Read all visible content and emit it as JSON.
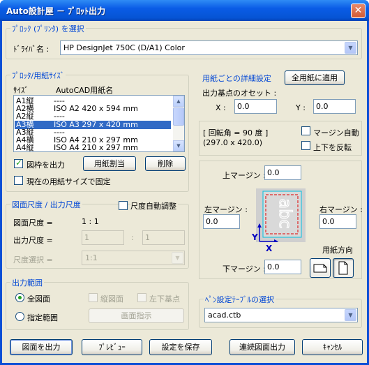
{
  "window": {
    "title": "Auto設計屋 － ﾌﾟﾛｯﾄ出力",
    "close_glyph": "✕"
  },
  "plotter": {
    "group_title": "ﾌﾟﾛｯｸ (ﾌﾟﾘﾝﾀ) を選択",
    "driver_label": "ﾄﾞﾗｲﾊﾞ名 :",
    "driver_value": "HP DesignJet 750C (D/A1) Color"
  },
  "paper_size": {
    "group_title": "ﾌﾟﾛｯﾀ/用紙ｻｲｽﾞ",
    "col_size": "ｻｲｽﾞ",
    "col_autocad": "AutoCAD用紙名",
    "rows": [
      {
        "size": "A1縦",
        "name": "----"
      },
      {
        "size": "A2横",
        "name": "ISO A2 420 x 594 mm"
      },
      {
        "size": "A2縦",
        "name": "----"
      },
      {
        "size": "A3横",
        "name": "ISO A3 297 x 420 mm"
      },
      {
        "size": "A3縦",
        "name": "----"
      },
      {
        "size": "A4横",
        "name": "ISO A4 210 x 297 mm"
      },
      {
        "size": "A4縦",
        "name": "ISO A4 210 x 297 mm"
      }
    ],
    "selected_index": 3,
    "frame_output_label": "図枠を出力",
    "frame_output_checked": true,
    "assign_button": "用紙割当",
    "delete_button": "削除",
    "fix_size_label": "現在の用紙サイズで固定",
    "fix_size_checked": false
  },
  "scale": {
    "group_title": "図面尺度 / 出力尺度",
    "auto_adjust_label": "尺度自動調整",
    "auto_adjust_checked": false,
    "drawing_scale_label": "図面尺度 =",
    "drawing_scale_value": "1 : 1",
    "output_scale_label": "出力尺度 =",
    "output_scale_a": "1",
    "output_scale_sep": ":",
    "output_scale_b": "1",
    "scale_select_label": "尺度選択 =",
    "scale_select_value": "1:1"
  },
  "range": {
    "group_title": "出力範囲",
    "all_label": "全図面",
    "specify_label": "指定範囲",
    "selected": "all",
    "vertical_label": "縦図面",
    "bottom_left_label": "左下基点",
    "area_button": "画面指示"
  },
  "detail": {
    "title": "用紙ごとの詳細設定",
    "apply_all_button": "全用紙に適用",
    "offset_label": "出力基点のオセット :",
    "x_label": "X :",
    "x_value": "0.0",
    "y_label": "Y :",
    "y_value": "0.0",
    "rotation_text": "[ 回転角 =     90  度 ]",
    "paper_dims": "(297.0 x 420.0)",
    "margin_auto_label": "マージン自動",
    "margin_auto_checked": false,
    "flip_label": "上下を反転",
    "flip_checked": false,
    "top_margin_label": "上マージン :",
    "top_margin_value": "0.0",
    "left_margin_label": "左マージン :",
    "left_margin_value": "0.0",
    "right_margin_label": "右マージン :",
    "right_margin_value": "0.0",
    "bottom_margin_label": "下マージン :",
    "bottom_margin_value": "0.0",
    "orientation_label": "用紙方向",
    "preview_text": "abc",
    "axis_x": "X",
    "axis_y": "Y"
  },
  "pen": {
    "group_title": "ﾍﾟﾝ設定ﾃｰﾌﾞﾙの選択",
    "value": "acad.ctb"
  },
  "footer": {
    "output_button": "図面を出力",
    "preview_button": "ﾌﾟﾚﾋﾞｭｰ",
    "save_button": "設定を保存",
    "batch_button": "連続図面出力",
    "cancel_button": "ｷｬﾝｾﾙ"
  },
  "colors": {
    "accent": "#0046d5",
    "selection": "#316ac5",
    "titlebar": "#0a5ce6"
  }
}
